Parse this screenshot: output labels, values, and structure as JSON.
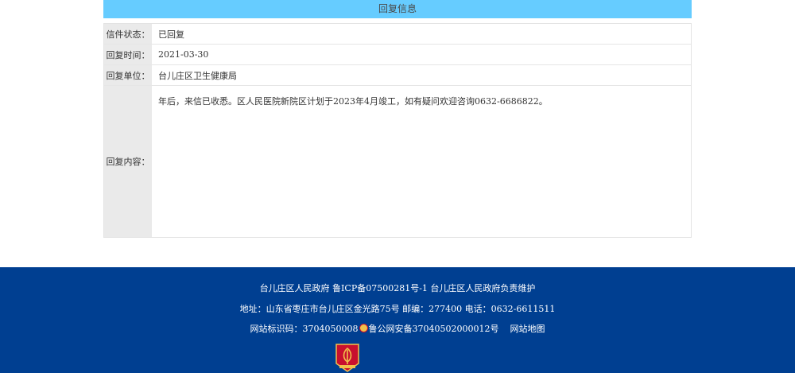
{
  "panel": {
    "title": "回复信息",
    "rows": [
      {
        "label": "信件状态：",
        "value": "已回复"
      },
      {
        "label": "回复时间：",
        "value": "2021-03-30"
      },
      {
        "label": "回复单位：",
        "value": "台儿庄区卫生健康局"
      },
      {
        "label": "回复内容：",
        "value": "年后，来信已收悉。区人民医院新院区计划于2023年4月竣工，如有疑问欢迎咨询0632-6686822。"
      }
    ]
  },
  "footer": {
    "line1": "台儿庄区人民政府  鲁ICP备07500281号-1  台儿庄区人民政府负责维护",
    "line2": "地址：山东省枣庄市台儿庄区金光路75号   邮编：277400 电话：0632-6611511",
    "site_code": "网站标识码：3704050008",
    "police_record": "鲁公网安备37040502000012号",
    "sitemap": "网站地图",
    "colors": {
      "background": "#003f91",
      "header": "#66ccff"
    }
  }
}
